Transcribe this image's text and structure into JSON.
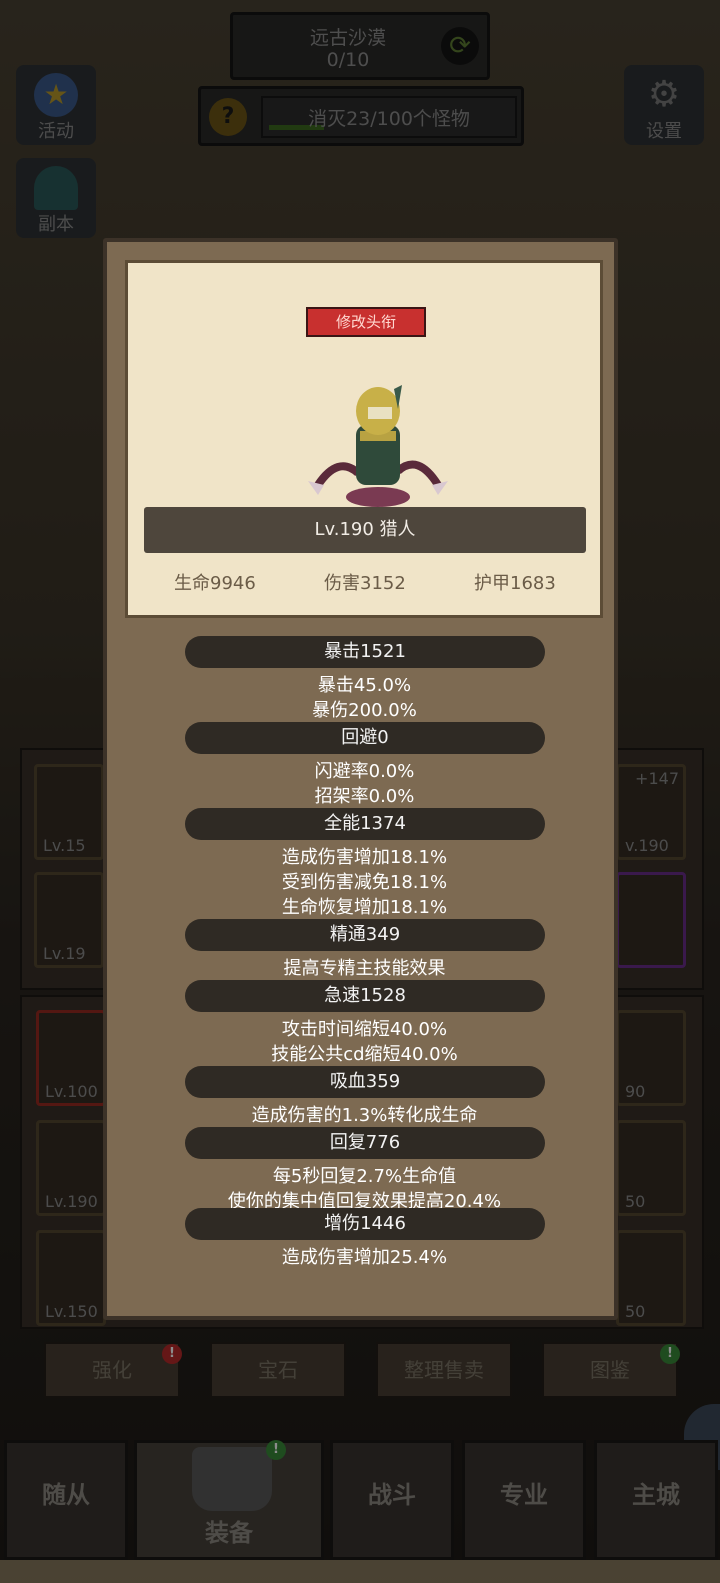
{
  "hud": {
    "location_name": "远古沙漠",
    "location_progress": "0/10",
    "quest_text": "消灭23/100个怪物",
    "quest_progress": 0.23,
    "help_icon_text": "?"
  },
  "side_buttons": {
    "activity": "活动",
    "dungeon": "副本",
    "settings": "设置"
  },
  "background_slots": {
    "left": [
      "Lv.15",
      "Lv.19",
      "Lv.100",
      "Lv.190",
      "Lv.150"
    ],
    "right": [
      "+147",
      "v.190",
      "90",
      "50",
      "50"
    ]
  },
  "bottom_actions": [
    "强化",
    "宝石",
    "整理售卖",
    "图鉴"
  ],
  "nav": [
    "随从",
    "装备",
    "战斗",
    "专业",
    "主城"
  ],
  "panel": {
    "rename_button": "修改头衔",
    "hero_name": "Lv.190 猎人",
    "base": {
      "hp": "生命9946",
      "damage": "伤害3152",
      "armor": "护甲1683"
    },
    "stats": [
      {
        "header": "暴击1521",
        "lines": [
          "暴击45.0%",
          "暴伤200.0%"
        ]
      },
      {
        "header": "回避0",
        "lines": [
          "闪避率0.0%",
          "招架率0.0%"
        ]
      },
      {
        "header": "全能1374",
        "lines": [
          "造成伤害增加18.1%",
          "受到伤害减免18.1%",
          "生命恢复增加18.1%"
        ]
      },
      {
        "header": "精通349",
        "lines": [
          "提高专精主技能效果"
        ]
      },
      {
        "header": "急速1528",
        "lines": [
          "攻击时间缩短40.0%",
          "技能公共cd缩短40.0%"
        ]
      },
      {
        "header": "吸血359",
        "lines": [
          "造成伤害的1.3%转化成生命"
        ]
      },
      {
        "header": "回复776",
        "lines": [
          "每5秒回复2.7%生命值",
          "使你的集中值回复效果提高20.4%"
        ]
      },
      {
        "header": "增伤1446",
        "lines": [
          "造成伤害增加25.4%"
        ]
      }
    ]
  },
  "colors": {
    "panel_bg": "#7d6a52",
    "parchment": "#f0e4c8",
    "rename_red": "#c8302f",
    "stat_header_bg": "#2f2a24"
  }
}
